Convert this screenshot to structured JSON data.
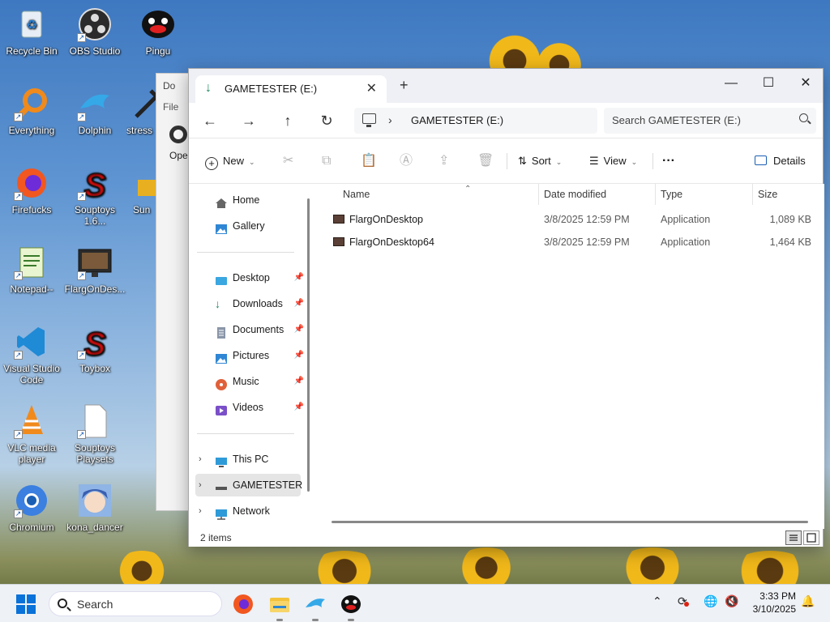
{
  "desktop": {
    "icons": [
      {
        "label": "Recycle Bin",
        "icon": "recycle-bin-icon"
      },
      {
        "label": "OBS Studio",
        "icon": "obs-studio-icon"
      },
      {
        "label": "Pingu",
        "icon": "pingu-icon"
      },
      {
        "label": "Everything",
        "icon": "magnifier-icon"
      },
      {
        "label": "Dolphin",
        "icon": "dolphin-icon"
      },
      {
        "label": "stress",
        "icon": "stress-icon"
      },
      {
        "label": "Firefucks",
        "icon": "firefox-icon"
      },
      {
        "label": "Souptoys 1.6...",
        "icon": "souptoys-icon"
      },
      {
        "label": "Sun",
        "icon": "sun-icon"
      },
      {
        "label": "Notepad--",
        "icon": "notepad-icon"
      },
      {
        "label": "FlargOnDes...",
        "icon": "flarg-icon"
      },
      {
        "label": "Visual Studio Code",
        "icon": "vscode-icon"
      },
      {
        "label": "Toybox",
        "icon": "toybox-icon"
      },
      {
        "label": "VLC media player",
        "icon": "vlc-icon"
      },
      {
        "label": "Souptoys Playsets",
        "icon": "document-icon"
      },
      {
        "label": "Chromium",
        "icon": "chromium-icon"
      },
      {
        "label": "kona_dancer",
        "icon": "anime-icon"
      }
    ]
  },
  "background_window": {
    "title": "Do",
    "menu": "File",
    "open_label": "Ope"
  },
  "explorer": {
    "tab_title": "GAMETESTER (E:)",
    "address_path": "GAMETESTER (E:)",
    "search_placeholder": "Search GAMETESTER (E:)",
    "toolbar": {
      "new_label": "New",
      "sort_label": "Sort",
      "view_label": "View",
      "more_label": "···",
      "details_label": "Details"
    },
    "nav": {
      "home": "Home",
      "gallery": "Gallery",
      "desktop": "Desktop",
      "downloads": "Downloads",
      "documents": "Documents",
      "pictures": "Pictures",
      "music": "Music",
      "videos": "Videos",
      "this_pc": "This PC",
      "gametester": "GAMETESTER (E:)",
      "network": "Network"
    },
    "columns": {
      "name": "Name",
      "date": "Date modified",
      "type": "Type",
      "size": "Size"
    },
    "files": [
      {
        "name": "FlargOnDesktop",
        "date": "3/8/2025 12:59 PM",
        "type": "Application",
        "size": "1,089 KB"
      },
      {
        "name": "FlargOnDesktop64",
        "date": "3/8/2025 12:59 PM",
        "type": "Application",
        "size": "1,464 KB"
      }
    ],
    "status_count": "2 items"
  },
  "taskbar": {
    "search_label": "Search",
    "time": "3:33 PM",
    "date": "3/10/2025"
  },
  "colors": {
    "accent": "#0a72d8",
    "window_bg": "#ffffff",
    "titlebar_bg": "#eef0f5"
  }
}
